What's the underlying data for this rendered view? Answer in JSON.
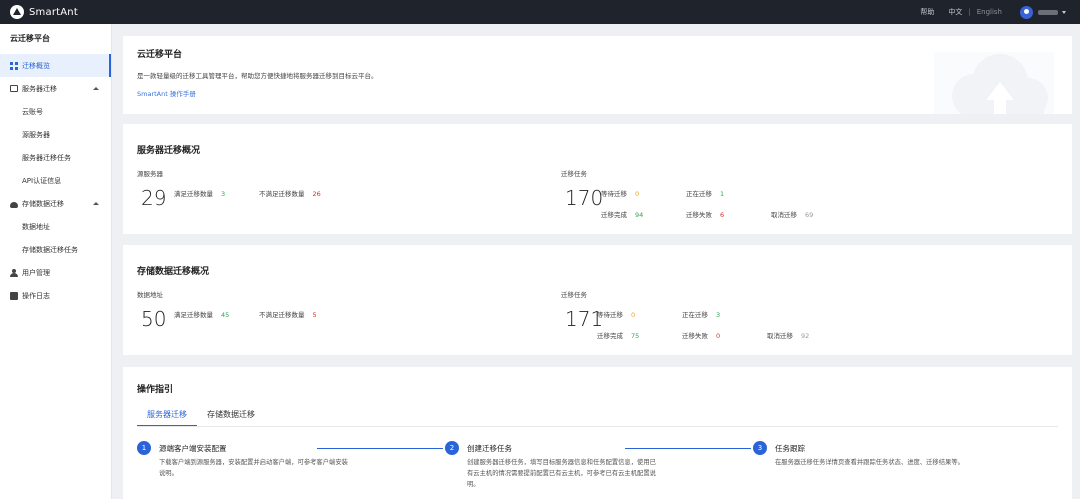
{
  "topbar": {
    "brand": "SmartAnt",
    "help": "帮助",
    "lang_zh": "中文",
    "lang_sep": "|",
    "lang_en": "English"
  },
  "sidebar": {
    "title": "云迁移平台",
    "items": [
      {
        "label": "迁移概览",
        "icon": "grid-icon",
        "active": true
      },
      {
        "label": "服务器迁移",
        "icon": "server-icon",
        "expanded": true
      },
      {
        "label": "云账号",
        "sub": true
      },
      {
        "label": "源服务器",
        "sub": true
      },
      {
        "label": "服务器迁移任务",
        "sub": true
      },
      {
        "label": "API认证信息",
        "sub": true
      },
      {
        "label": "存储数据迁移",
        "icon": "cloud-icon",
        "expanded": true
      },
      {
        "label": "数据地址",
        "sub": true
      },
      {
        "label": "存储数据迁移任务",
        "sub": true
      },
      {
        "label": "用户管理",
        "icon": "user-icon"
      },
      {
        "label": "操作日志",
        "icon": "log-icon"
      }
    ]
  },
  "intro": {
    "title": "云迁移平台",
    "desc": "是一款轻量级的迁移工具管理平台，帮助您方便快捷地将服务器迁移到目标云平台。",
    "link": "SmartAnt 操作手册"
  },
  "server_overview": {
    "title": "服务器迁移概况",
    "left_label": "源服务器",
    "left_total": "29",
    "meet_label": "满足迁移数量",
    "meet_value": "3",
    "notmeet_label": "不满足迁移数量",
    "notmeet_value": "26",
    "right_label": "迁移任务",
    "right_total": "170",
    "waiting_label": "等待迁移",
    "waiting_value": "0",
    "running_label": "正在迁移",
    "running_value": "1",
    "done_label": "迁移完成",
    "done_value": "94",
    "failed_label": "迁移失败",
    "failed_value": "6",
    "cancel_label": "取消迁移",
    "cancel_value": "69"
  },
  "storage_overview": {
    "title": "存储数据迁移概况",
    "left_label": "数据地址",
    "left_total": "50",
    "meet_label": "满足迁移数量",
    "meet_value": "45",
    "notmeet_label": "不满足迁移数量",
    "notmeet_value": "5",
    "right_label": "迁移任务",
    "right_total": "171",
    "waiting_label": "等待迁移",
    "waiting_value": "0",
    "running_label": "正在迁移",
    "running_value": "3",
    "done_label": "迁移完成",
    "done_value": "75",
    "failed_label": "迁移失败",
    "failed_value": "0",
    "cancel_label": "取消迁移",
    "cancel_value": "92"
  },
  "guide": {
    "title": "操作指引",
    "tabs": [
      "服务器迁移",
      "存储数据迁移"
    ],
    "steps": [
      {
        "num": "1",
        "title": "源端客户端安装配置",
        "desc": "下载客户端到源服务器，安装配置并启动客户端，可参考客户端安装说明。"
      },
      {
        "num": "2",
        "title": "创建迁移任务",
        "desc": "创建服务器迁移任务，填写目标服务器信息和任务配置信息，使用已有云主机的情况需要提前配置已有云主机，可参考已有云主机配置说明。"
      },
      {
        "num": "3",
        "title": "任务跟踪",
        "desc": "在服务器迁移任务详情页查看并跟踪任务状态、进度、迁移结果等。"
      }
    ]
  },
  "colors": {
    "accent": "#2b63d9",
    "success": "#2ea44f",
    "danger": "#d93025",
    "warning": "#f0a020"
  }
}
